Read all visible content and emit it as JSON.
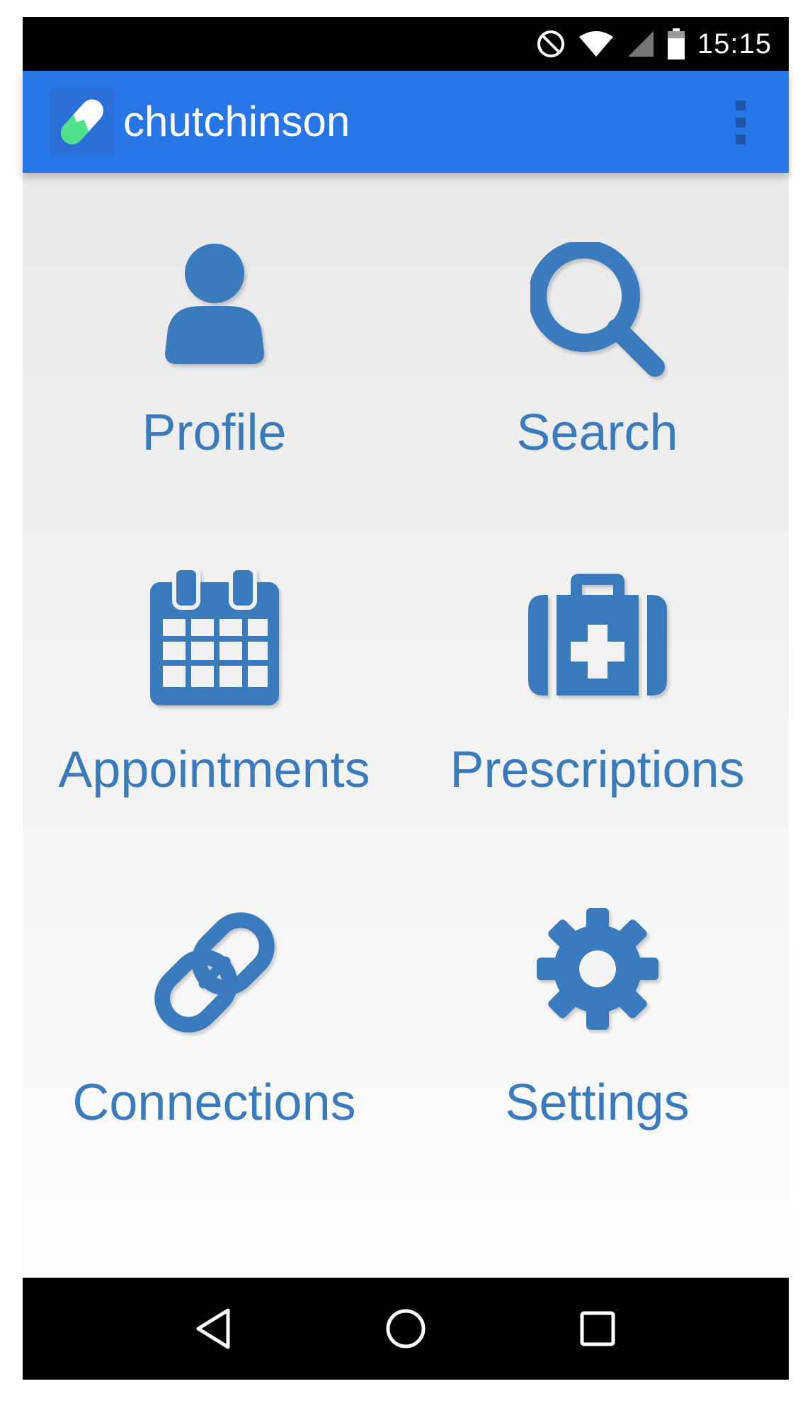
{
  "status_bar": {
    "time": "15:15",
    "icons": [
      "do-not-disturb-icon",
      "wifi-icon",
      "cell-signal-icon",
      "battery-icon"
    ]
  },
  "app_bar": {
    "title": "chutchinson",
    "logo_icon": "pill-logo-icon",
    "menu_icon": "overflow-menu-icon",
    "background": "#2676e8"
  },
  "tiles": [
    {
      "label": "Profile",
      "icon": "person-icon"
    },
    {
      "label": "Search",
      "icon": "search-icon"
    },
    {
      "label": "Appointments",
      "icon": "calendar-icon"
    },
    {
      "label": "Prescriptions",
      "icon": "medical-kit-icon"
    },
    {
      "label": "Connections",
      "icon": "link-icon"
    },
    {
      "label": "Settings",
      "icon": "gear-icon"
    }
  ],
  "nav_bar": {
    "buttons": [
      "back-icon",
      "home-icon",
      "recents-icon"
    ]
  },
  "colors": {
    "accent": "#3a7bbd",
    "app_bar": "#2676e8",
    "logo_green": "#4fe08a"
  }
}
